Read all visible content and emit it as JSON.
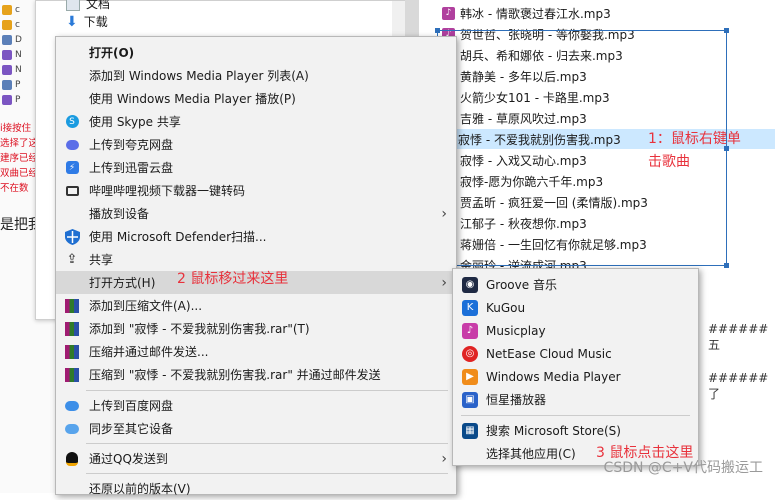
{
  "background": {
    "left_files": [
      "c",
      "c",
      "D",
      "N",
      "N",
      "P",
      "P"
    ],
    "left_red_lines": [
      "i接按住",
      "选择了这",
      "建序已经",
      "双曲已经",
      "不在数"
    ],
    "left_big_text": "是把我",
    "explorer_items": [
      {
        "label": "文档",
        "icon": "document-icon"
      },
      {
        "label": "下载",
        "icon": "download-arrow-icon"
      }
    ],
    "markdown_lines": [
      "###### 五",
      "###### 了"
    ]
  },
  "songs": [
    "韩冰 - 情歌褒过春江水.mp3",
    "贺世哲、张晓明 - 等你娶我.mp3",
    "胡兵、希和娜依 - 归去来.mp3",
    "黄静美 - 多年以后.mp3",
    "火箭少女101 - 卡路里.mp3",
    "吉雅 - 草原风吹过.mp3",
    "寂悸 - 不爱我就别伤害我.mp3",
    "寂悸 - 入戏又动心.mp3",
    "寂悸-愿为你跪六千年.mp3",
    "贾孟昕 - 疯狂爱一回 (柔情版).mp3",
    "江郁子 - 秋夜想你.mp3",
    "蒋姗倍 - 一生回忆有你就足够.mp3",
    "金丽玲 - 逆流成河.mp3"
  ],
  "selected_song_index": 6,
  "annotations": {
    "step1_line1": "1：鼠标右键单",
    "step1_line2": "击歌曲",
    "step2": "2 鼠标移过来这里",
    "step3": "3 鼠标点击这里"
  },
  "context_menu": {
    "items": [
      {
        "label": "打开(O)",
        "icon": "",
        "bold": true
      },
      {
        "label": "添加到 Windows Media Player 列表(A)",
        "icon": ""
      },
      {
        "label": "使用 Windows Media Player 播放(P)",
        "icon": ""
      },
      {
        "label": "使用 Skype 共享",
        "icon": "skype-icon"
      },
      {
        "label": "上传到夸克网盘",
        "icon": "quark-cloud-icon"
      },
      {
        "label": "上传到迅雷云盘",
        "icon": "thunder-cloud-icon"
      },
      {
        "label": "哔哩哔哩视频下载器一键转码",
        "icon": "bilibili-icon"
      },
      {
        "label": "播放到设备",
        "icon": "",
        "submenu": true
      },
      {
        "label": "使用 Microsoft Defender扫描...",
        "icon": "defender-shield-icon"
      },
      {
        "label": "共享",
        "icon": "share-icon"
      },
      {
        "label": "打开方式(H)",
        "icon": "",
        "submenu": true,
        "hover": true
      },
      {
        "label": "添加到压缩文件(A)...",
        "icon": "winrar-icon"
      },
      {
        "label": "添加到 \"寂悸 - 不爱我就别伤害我.rar\"(T)",
        "icon": "winrar-icon"
      },
      {
        "label": "压缩并通过邮件发送...",
        "icon": "winrar-icon"
      },
      {
        "label": "压缩到 \"寂悸 - 不爱我就别伤害我.rar\" 并通过邮件发送",
        "icon": "winrar-icon"
      },
      {
        "label": "上传到百度网盘",
        "icon": "baidu-cloud-icon"
      },
      {
        "label": "同步至其它设备",
        "icon": "baidu-sync-icon"
      },
      {
        "label": "通过QQ发送到",
        "icon": "qq-penguin-icon",
        "submenu": true
      },
      {
        "label": "还原以前的版本(V)",
        "icon": ""
      }
    ]
  },
  "open_with_submenu": {
    "apps": [
      {
        "label": "Groove 音乐",
        "icon": "groove-music-icon",
        "color": "#1f2a44"
      },
      {
        "label": "KuGou",
        "icon": "kugou-icon",
        "color": "#1b6fd8"
      },
      {
        "label": "Musicplay",
        "icon": "musicplay-icon",
        "color": "#c83ca8"
      },
      {
        "label": "NetEase Cloud Music",
        "icon": "netease-music-icon",
        "color": "#e02424"
      },
      {
        "label": "Windows Media Player",
        "icon": "wmp-icon",
        "color": "#f08c1a"
      },
      {
        "label": "恒星播放器",
        "icon": "hengxing-player-icon",
        "color": "#2a62c9"
      }
    ],
    "store": {
      "label": "搜索 Microsoft Store(S)",
      "icon": "store-icon",
      "color": "#0a4a8a"
    },
    "choose_other": "选择其他应用(C)"
  },
  "watermark": "CSDN @C+V代码搬运工"
}
